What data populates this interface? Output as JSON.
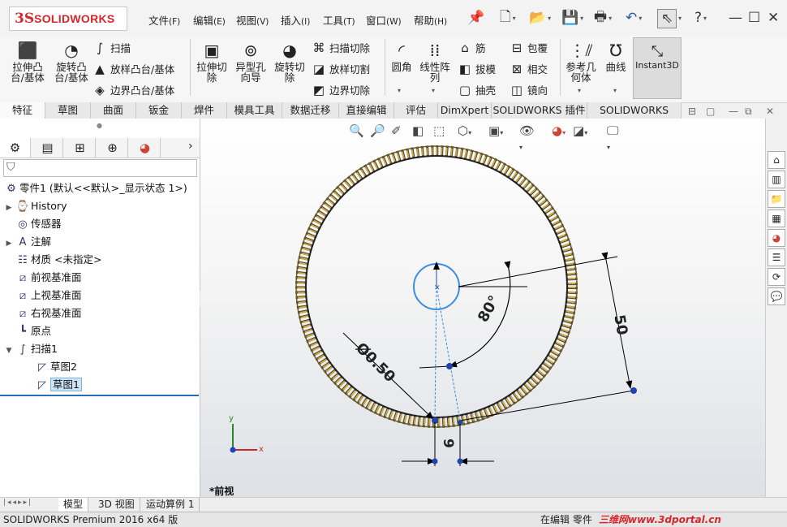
{
  "app": {
    "logo_prefix": "3S",
    "logo_text": "SOLIDWORKS"
  },
  "menu": [
    {
      "label": "文件",
      "key": "(F)"
    },
    {
      "label": "编辑",
      "key": "(E)"
    },
    {
      "label": "视图",
      "key": "(V)"
    },
    {
      "label": "插入",
      "key": "(I)"
    },
    {
      "label": "工具",
      "key": "(T)"
    },
    {
      "label": "窗口",
      "key": "(W)"
    },
    {
      "label": "帮助",
      "key": "(H)"
    }
  ],
  "ribbon": {
    "extrude_boss": "拉伸凸\n台/基体",
    "revolve_boss": "旋转凸\n台/基体",
    "sweep": "扫描",
    "loft_boss": "放样凸台/基体",
    "boundary_boss": "边界凸台/基体",
    "extrude_cut": "拉伸切\n除",
    "hole_wizard": "异型孔\n向导",
    "revolve_cut": "旋转切\n除",
    "sweep_cut": "扫描切除",
    "loft_cut": "放样切割",
    "boundary_cut": "边界切除",
    "fillet": "圆角",
    "linear_pattern": "线性阵\n列",
    "rib": "筋",
    "draft": "拔模",
    "shell": "抽壳",
    "wrap": "包覆",
    "intersect": "相交",
    "mirror": "镜向",
    "reference_geometry": "参考几\n何体",
    "curves": "曲线",
    "instant3d": "Instant3D"
  },
  "tabs": [
    "特征",
    "草图",
    "曲面",
    "钣金",
    "焊件",
    "模具工具",
    "数据迁移",
    "直接编辑",
    "评估",
    "DimXpert",
    "SOLIDWORKS 插件",
    "SOLIDWORKS MBD"
  ],
  "tree": {
    "part": "零件1  (默认<<默认>_显示状态 1>)",
    "items": [
      {
        "label": "History"
      },
      {
        "label": "传感器"
      },
      {
        "label": "注解"
      },
      {
        "label": "材质 <未指定>"
      },
      {
        "label": "前视基准面"
      },
      {
        "label": "上视基准面"
      },
      {
        "label": "右视基准面"
      },
      {
        "label": "原点"
      },
      {
        "label": "扫描1"
      },
      {
        "label": "草图2"
      },
      {
        "label": "草图1"
      }
    ]
  },
  "dimensions": {
    "angle": "80°",
    "diameter": "Ø0.50",
    "length": "50",
    "offset": "9"
  },
  "axes": {
    "x": "x",
    "y": "y"
  },
  "view_label": "*前视",
  "bottom_tabs": [
    "模型",
    "3D 视图",
    "运动算例 1"
  ],
  "status": {
    "left": "SOLIDWORKS Premium 2016 x64 版",
    "mode": "在编辑 零件",
    "watermark": "三维网www.3dportal.cn"
  },
  "colors": {
    "accent": "#d7262b",
    "sketch_blue": "#3a8de0",
    "selection": "#cce4f7"
  }
}
